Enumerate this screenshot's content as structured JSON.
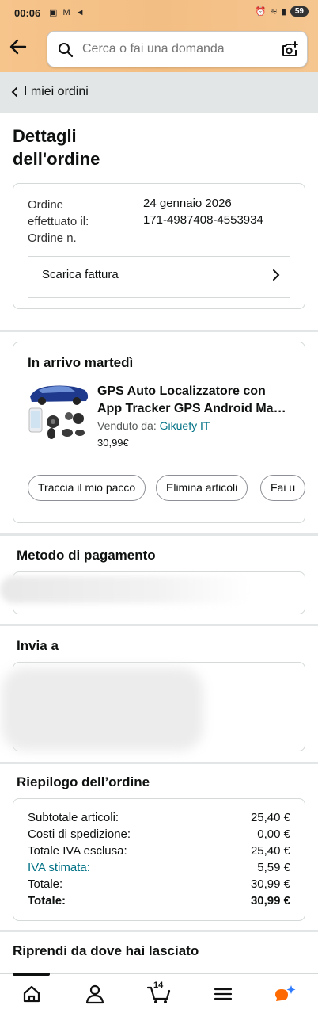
{
  "status_bar": {
    "time": "00:06",
    "battery": "59"
  },
  "search": {
    "placeholder": "Cerca o fai una domanda"
  },
  "breadcrumb": {
    "label": "I miei ordini"
  },
  "page": {
    "title_line1": "Dettagli",
    "title_line2": "dell'ordine"
  },
  "order_info": {
    "date_label_line1": "Ordine",
    "date_label_line2": "effettuato il:",
    "number_label": "Ordine n.",
    "date_value": "24 gennaio 2026",
    "number_value": "171-4987408-4553934",
    "invoice_label": "Scarica fattura"
  },
  "shipment": {
    "title": "In arrivo martedì",
    "product_title_line1": "GPS Auto Localizzatore con",
    "product_title_line2": "App Tracker GPS Android Ma…",
    "sold_by_prefix": "Venduto da: ",
    "seller": "Gikuefy IT",
    "price": "30,99€",
    "actions": [
      "Traccia il mio pacco",
      "Elimina articoli",
      "Fai u"
    ]
  },
  "payment": {
    "title": "Metodo di pagamento"
  },
  "ship_to": {
    "title": "Invia a"
  },
  "summary": {
    "title": "Riepilogo dell’ordine",
    "rows": [
      {
        "label": "Subtotale articoli:",
        "value": "25,40 €"
      },
      {
        "label": "Costi di spedizione:",
        "value": "0,00 €"
      },
      {
        "label": "Totale IVA esclusa:",
        "value": "25,40 €"
      },
      {
        "label": "IVA stimata:",
        "value": "5,59 €"
      },
      {
        "label": "Totale:",
        "value": "30,99 €"
      },
      {
        "label": "Totale:",
        "value": "30,99 €"
      }
    ]
  },
  "resume": {
    "title": "Riprendi da dove hai lasciato"
  },
  "bottom_nav": {
    "items": [
      "home-icon",
      "account-icon",
      "cart-icon",
      "menu-icon",
      "rufus-assistant-icon"
    ],
    "cart_count": "14"
  },
  "colors": {
    "header_gradient": "#f3be83",
    "link": "#007185",
    "breadcrumb_bg": "#e3e6e6",
    "assistant_orange": "#ff6a00",
    "assistant_blue": "#2f7bff"
  }
}
